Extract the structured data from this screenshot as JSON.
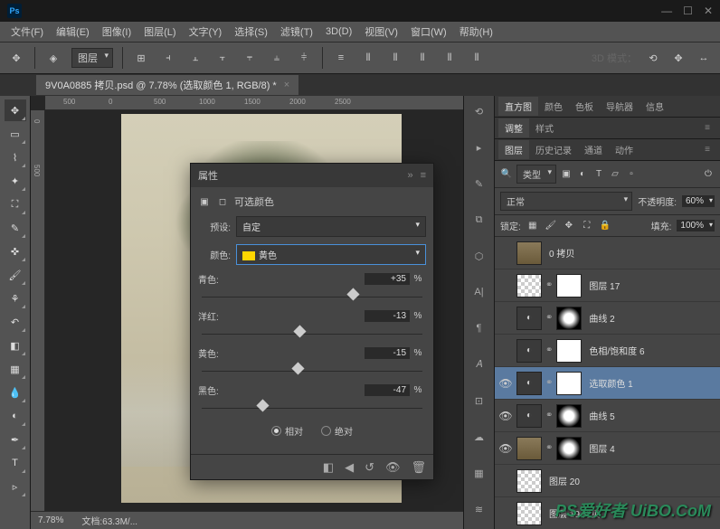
{
  "titlebar": {
    "ps": "Ps"
  },
  "window_controls": {
    "min": "—",
    "max": "☐",
    "close": "✕"
  },
  "menu": [
    "文件(F)",
    "编辑(E)",
    "图像(I)",
    "图层(L)",
    "文字(Y)",
    "选择(S)",
    "滤镜(T)",
    "3D(D)",
    "视图(V)",
    "窗口(W)",
    "帮助(H)"
  ],
  "optbar": {
    "layer_sel": "图层",
    "mode3d": "3D 模式："
  },
  "doctab": {
    "title": "9V0A0885 拷贝.psd @ 7.78% (选取颜色 1, RGB/8) *",
    "close": "×"
  },
  "ruler_h": [
    "500",
    "0",
    "500",
    "1000",
    "1500",
    "2000",
    "2500"
  ],
  "ruler_v": [
    "0",
    "500"
  ],
  "status": {
    "zoom": "7.78%",
    "doc": "文档:63.3M/..."
  },
  "props": {
    "title": "属性",
    "collapse": "»",
    "menu": "≡",
    "type": "可选颜色",
    "preset_label": "预设:",
    "preset_value": "自定",
    "color_label": "颜色:",
    "color_value": "黄色",
    "sliders": [
      {
        "label": "青色:",
        "value": "+35",
        "pct": "%",
        "pos": 68
      },
      {
        "label": "洋红:",
        "value": "-13",
        "pct": "%",
        "pos": 44
      },
      {
        "label": "黄色:",
        "value": "-15",
        "pct": "%",
        "pos": 43
      },
      {
        "label": "黑色:",
        "value": "-47",
        "pct": "%",
        "pos": 27
      }
    ],
    "radio_rel": "相对",
    "radio_abs": "绝对"
  },
  "panel_tabs_1": [
    "直方图",
    "颜色",
    "色板",
    "导航器",
    "信息"
  ],
  "panel_tabs_2": [
    "调整",
    "样式"
  ],
  "panel_tabs_3": [
    "图层",
    "历史记录",
    "通道",
    "动作"
  ],
  "layers_filter": {
    "kind": "类型"
  },
  "layers_blend": {
    "mode": "正常",
    "opacity_label": "不透明度:",
    "opacity": "60%"
  },
  "layers_lock": {
    "label": "锁定:",
    "fill_label": "填充:",
    "fill": "100%"
  },
  "layers": [
    {
      "eye": false,
      "name": "0 拷贝",
      "thumbs": [
        "img"
      ]
    },
    {
      "eye": false,
      "name": "图层 17",
      "thumbs": [
        "checker",
        "link",
        "white"
      ]
    },
    {
      "eye": false,
      "name": "曲线 2",
      "thumbs": [
        "adj",
        "link",
        "mask"
      ]
    },
    {
      "eye": false,
      "name": "色相/饱和度 6",
      "thumbs": [
        "adj",
        "link",
        "white"
      ]
    },
    {
      "eye": true,
      "name": "选取颜色 1",
      "thumbs": [
        "adj",
        "link",
        "white"
      ],
      "selected": true
    },
    {
      "eye": true,
      "name": "曲线 5",
      "thumbs": [
        "adj",
        "link",
        "mask"
      ]
    },
    {
      "eye": true,
      "name": "图层 4",
      "thumbs": [
        "img",
        "link",
        "mask"
      ]
    },
    {
      "eye": false,
      "name": "图层 20",
      "thumbs": [
        "checker"
      ]
    },
    {
      "eye": false,
      "name": "图层 19 拷贝",
      "thumbs": [
        "checker"
      ]
    }
  ],
  "watermark": "PS爱好者 UiBO.CoM"
}
